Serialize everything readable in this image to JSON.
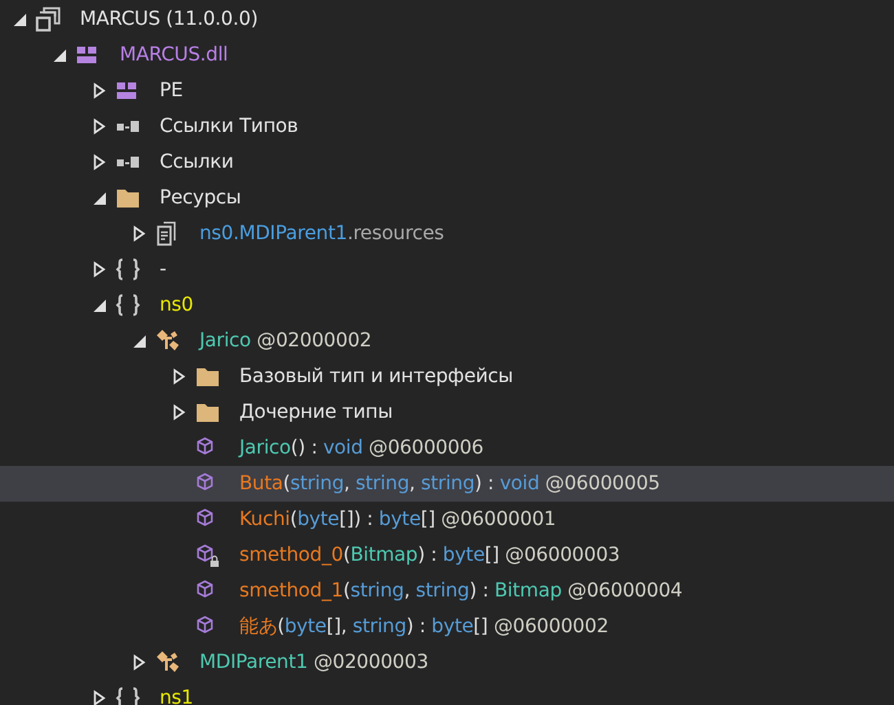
{
  "tree": [
    {
      "kind": "assembly",
      "expanded": true,
      "selected": false,
      "parts": [
        {
          "text": "MARCUS (11.0.0.0)",
          "kind": "plain"
        }
      ],
      "children": [
        {
          "kind": "module",
          "expanded": true,
          "selected": false,
          "parts": [
            {
              "text": "MARCUS.dll",
              "kind": "module"
            }
          ],
          "children": [
            {
              "kind": "module",
              "expanded": false,
              "selected": false,
              "parts": [
                {
                  "text": "PE",
                  "kind": "plain"
                }
              ]
            },
            {
              "kind": "references",
              "expanded": false,
              "selected": false,
              "parts": [
                {
                  "text": "Ссылки Типов",
                  "kind": "plain"
                }
              ]
            },
            {
              "kind": "references",
              "expanded": false,
              "selected": false,
              "parts": [
                {
                  "text": "Ссылки",
                  "kind": "plain"
                }
              ]
            },
            {
              "kind": "folder",
              "expanded": true,
              "selected": false,
              "parts": [
                {
                  "text": "Ресурсы",
                  "kind": "plain"
                }
              ],
              "children": [
                {
                  "kind": "resource",
                  "expanded": false,
                  "selected": false,
                  "parts": [
                    {
                      "text": "ns0.MDIParent1",
                      "kind": "resname"
                    },
                    {
                      "text": ".resources",
                      "kind": "resext"
                    }
                  ]
                }
              ]
            },
            {
              "kind": "namespace",
              "expanded": false,
              "selected": false,
              "parts": [
                {
                  "text": "-",
                  "kind": "plain"
                }
              ]
            },
            {
              "kind": "namespace",
              "expanded": true,
              "selected": false,
              "parts": [
                {
                  "text": "ns0",
                  "kind": "namespace"
                }
              ],
              "children": [
                {
                  "kind": "class",
                  "expanded": true,
                  "selected": false,
                  "parts": [
                    {
                      "text": "Jarico",
                      "kind": "type"
                    },
                    {
                      "text": " @02000002",
                      "kind": "token"
                    }
                  ],
                  "children": [
                    {
                      "kind": "folder",
                      "expanded": false,
                      "selected": false,
                      "parts": [
                        {
                          "text": "Базовый тип и интерфейсы",
                          "kind": "plain"
                        }
                      ]
                    },
                    {
                      "kind": "folder",
                      "expanded": false,
                      "selected": false,
                      "parts": [
                        {
                          "text": "Дочерние типы",
                          "kind": "plain"
                        }
                      ]
                    },
                    {
                      "kind": "method",
                      "selected": false,
                      "parts": [
                        {
                          "text": "Jarico",
                          "kind": "type"
                        },
                        {
                          "text": "() : ",
                          "kind": "punct"
                        },
                        {
                          "text": "void",
                          "kind": "keyword"
                        },
                        {
                          "text": " @06000006",
                          "kind": "token"
                        }
                      ]
                    },
                    {
                      "kind": "method",
                      "selected": true,
                      "parts": [
                        {
                          "text": "Buta",
                          "kind": "method"
                        },
                        {
                          "text": "(",
                          "kind": "punct"
                        },
                        {
                          "text": "string",
                          "kind": "keyword"
                        },
                        {
                          "text": ", ",
                          "kind": "punct"
                        },
                        {
                          "text": "string",
                          "kind": "keyword"
                        },
                        {
                          "text": ", ",
                          "kind": "punct"
                        },
                        {
                          "text": "string",
                          "kind": "keyword"
                        },
                        {
                          "text": ") : ",
                          "kind": "punct"
                        },
                        {
                          "text": "void",
                          "kind": "keyword"
                        },
                        {
                          "text": " @06000005",
                          "kind": "token"
                        }
                      ]
                    },
                    {
                      "kind": "method",
                      "selected": false,
                      "parts": [
                        {
                          "text": "Kuchi",
                          "kind": "method"
                        },
                        {
                          "text": "(",
                          "kind": "punct"
                        },
                        {
                          "text": "byte",
                          "kind": "keyword"
                        },
                        {
                          "text": "[]) : ",
                          "kind": "punct"
                        },
                        {
                          "text": "byte",
                          "kind": "keyword"
                        },
                        {
                          "text": "[]",
                          "kind": "punct"
                        },
                        {
                          "text": " @06000001",
                          "kind": "token"
                        }
                      ]
                    },
                    {
                      "kind": "private-method",
                      "selected": false,
                      "parts": [
                        {
                          "text": "smethod_0",
                          "kind": "method"
                        },
                        {
                          "text": "(",
                          "kind": "punct"
                        },
                        {
                          "text": "Bitmap",
                          "kind": "type"
                        },
                        {
                          "text": ") : ",
                          "kind": "punct"
                        },
                        {
                          "text": "byte",
                          "kind": "keyword"
                        },
                        {
                          "text": "[]",
                          "kind": "punct"
                        },
                        {
                          "text": " @06000003",
                          "kind": "token"
                        }
                      ]
                    },
                    {
                      "kind": "method",
                      "selected": false,
                      "parts": [
                        {
                          "text": "smethod_1",
                          "kind": "method"
                        },
                        {
                          "text": "(",
                          "kind": "punct"
                        },
                        {
                          "text": "string",
                          "kind": "keyword"
                        },
                        {
                          "text": ", ",
                          "kind": "punct"
                        },
                        {
                          "text": "string",
                          "kind": "keyword"
                        },
                        {
                          "text": ") : ",
                          "kind": "punct"
                        },
                        {
                          "text": "Bitmap",
                          "kind": "type"
                        },
                        {
                          "text": " @06000004",
                          "kind": "token"
                        }
                      ]
                    },
                    {
                      "kind": "method",
                      "selected": false,
                      "parts": [
                        {
                          "text": "能あ",
                          "kind": "method"
                        },
                        {
                          "text": "(",
                          "kind": "punct"
                        },
                        {
                          "text": "byte",
                          "kind": "keyword"
                        },
                        {
                          "text": "[], ",
                          "kind": "punct"
                        },
                        {
                          "text": "string",
                          "kind": "keyword"
                        },
                        {
                          "text": ") : ",
                          "kind": "punct"
                        },
                        {
                          "text": "byte",
                          "kind": "keyword"
                        },
                        {
                          "text": "[]",
                          "kind": "punct"
                        },
                        {
                          "text": " @06000002",
                          "kind": "token"
                        }
                      ]
                    }
                  ]
                },
                {
                  "kind": "class",
                  "expanded": false,
                  "selected": false,
                  "parts": [
                    {
                      "text": "MDIParent1",
                      "kind": "type"
                    },
                    {
                      "text": " @02000003",
                      "kind": "token"
                    }
                  ]
                }
              ]
            },
            {
              "kind": "namespace",
              "expanded": false,
              "selected": false,
              "parts": [
                {
                  "text": "ns1",
                  "kind": "namespace"
                }
              ]
            }
          ]
        }
      ]
    }
  ]
}
